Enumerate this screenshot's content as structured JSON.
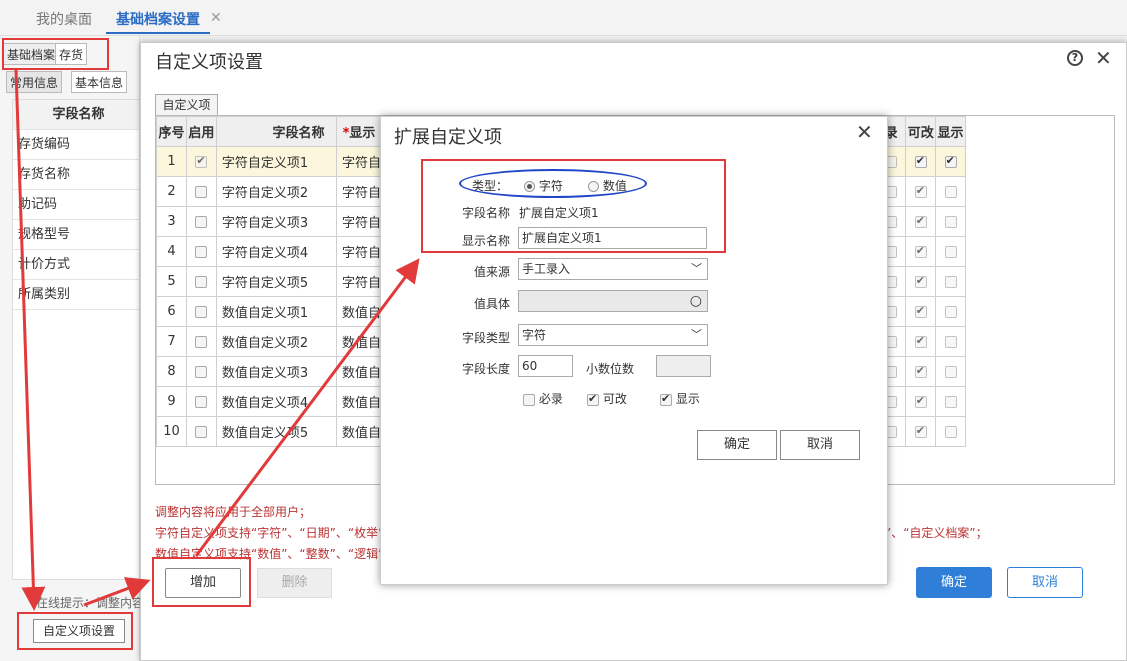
{
  "tabs": {
    "desktop": "我的桌面",
    "basic": "基础档案设置",
    "close": "✕"
  },
  "left": {
    "tab_basic": "基础档案",
    "tab_inventory": "存货",
    "tab_common": "常用信息",
    "tab_basicinfo": "基本信息",
    "header": "字段名称",
    "rows": [
      "存货编码",
      "存货名称",
      "助记码",
      "规格型号",
      "计价方式",
      "所属类别"
    ],
    "hint": "在线提示：调整内容",
    "custom_button": "自定义项设置"
  },
  "dialog": {
    "title": "自定义项设置",
    "subtab": "自定义项",
    "headers": {
      "seq": "序号",
      "enabled": "启用",
      "field": "字段名称",
      "display": "显示",
      "req_mark": "*",
      "required": "录",
      "editable": "可改",
      "show": "显示"
    },
    "rows": [
      {
        "seq": "1",
        "field": "字符自定义项1",
        "display": "字符自"
      },
      {
        "seq": "2",
        "field": "字符自定义项2",
        "display": "字符自"
      },
      {
        "seq": "3",
        "field": "字符自定义项3",
        "display": "字符自"
      },
      {
        "seq": "4",
        "field": "字符自定义项4",
        "display": "字符自"
      },
      {
        "seq": "5",
        "field": "字符自定义项5",
        "display": "字符自"
      },
      {
        "seq": "6",
        "field": "数值自定义项1",
        "display": "数值自"
      },
      {
        "seq": "7",
        "field": "数值自定义项2",
        "display": "数值自"
      },
      {
        "seq": "8",
        "field": "数值自定义项3",
        "display": "数值自"
      },
      {
        "seq": "9",
        "field": "数值自定义项4",
        "display": "数值自"
      },
      {
        "seq": "10",
        "field": "数值自定义项5",
        "display": "数值自"
      }
    ],
    "notes": [
      "调整内容将应用于全部用户；",
      "字符自定义项支持“字符”、“日期”、“枚举”、",
      "数值自定义项支持“数值”、“整数”、“逻辑”的",
      "案”、“自定义档案”；"
    ],
    "add": "增加",
    "delete": "删除",
    "ok": "确定",
    "cancel": "取消"
  },
  "ext": {
    "title": "扩展自定义项",
    "type_label": "类型：",
    "type_char": "字符",
    "type_num": "数值",
    "field_name_label": "字段名称",
    "field_name_value": "扩展自定义项1",
    "display_name_label": "显示名称",
    "display_name_value": "扩展自定义项1",
    "value_source_label": "值来源",
    "value_source_value": "手工录入",
    "value_entity_label": "值具体",
    "field_type_label": "字段类型",
    "field_type_value": "字符",
    "field_length_label": "字段长度",
    "field_length_value": "60",
    "decimal_label": "小数位数",
    "required": "必录",
    "editable": "可改",
    "show": "显示",
    "ok": "确定",
    "cancel": "取消"
  }
}
